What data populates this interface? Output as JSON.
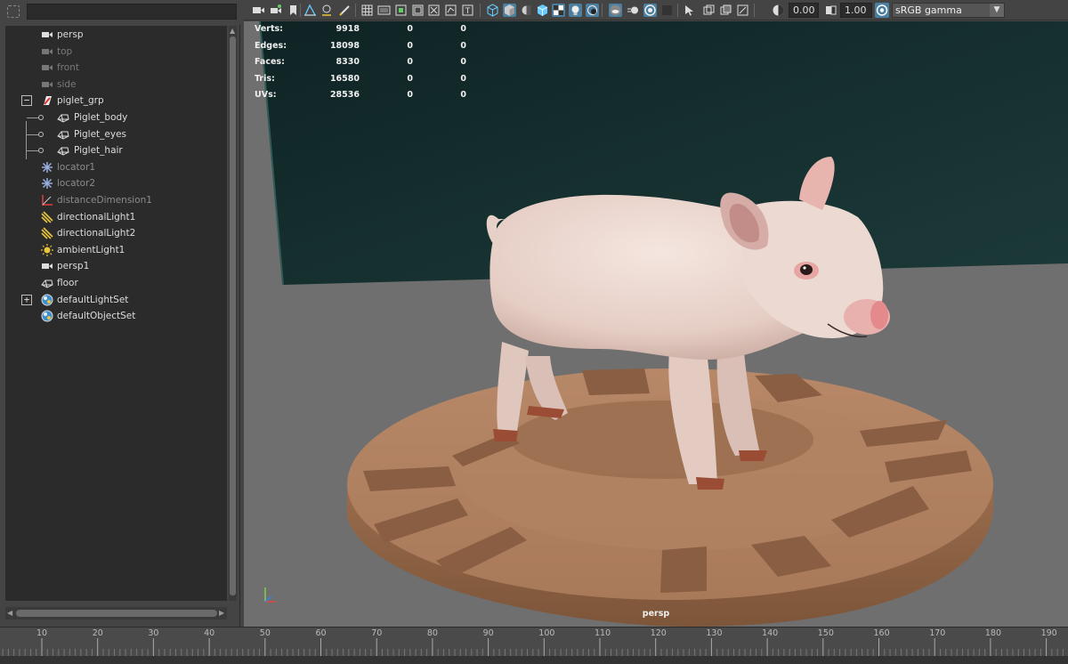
{
  "outliner": {
    "search_value": "",
    "items": [
      {
        "label": "persp",
        "icon": "camera-icon",
        "state": "normal"
      },
      {
        "label": "top",
        "icon": "camera-icon",
        "state": "dim"
      },
      {
        "label": "front",
        "icon": "camera-icon",
        "state": "dim"
      },
      {
        "label": "side",
        "icon": "camera-icon",
        "state": "dim"
      },
      {
        "label": "piglet_grp",
        "icon": "group-transform-icon",
        "state": "normal",
        "expander": "−"
      },
      {
        "label": "Piglet_body",
        "icon": "mesh-icon",
        "state": "normal"
      },
      {
        "label": "Piglet_eyes",
        "icon": "mesh-icon",
        "state": "normal"
      },
      {
        "label": "Piglet_hair",
        "icon": "mesh-icon",
        "state": "normal"
      },
      {
        "label": "locator1",
        "icon": "locator-icon",
        "state": "grey"
      },
      {
        "label": "locator2",
        "icon": "locator-icon",
        "state": "grey"
      },
      {
        "label": "distanceDimension1",
        "icon": "distance-icon",
        "state": "grey"
      },
      {
        "label": "directionalLight1",
        "icon": "directional-light-icon",
        "state": "normal"
      },
      {
        "label": "directionalLight2",
        "icon": "directional-light-icon",
        "state": "normal"
      },
      {
        "label": "ambientLight1",
        "icon": "ambient-light-icon",
        "state": "normal"
      },
      {
        "label": "persp1",
        "icon": "camera-icon",
        "state": "normal"
      },
      {
        "label": "floor",
        "icon": "mesh-icon",
        "state": "normal"
      },
      {
        "label": "defaultLightSet",
        "icon": "set-icon",
        "state": "normal",
        "expander": "+"
      },
      {
        "label": "defaultObjectSet",
        "icon": "set-icon",
        "state": "normal"
      }
    ]
  },
  "toolbar": {
    "exposure_value": "0.00",
    "gamma_value": "1.00",
    "color_management": "sRGB gamma"
  },
  "hud": {
    "rows": [
      {
        "label": "Verts:",
        "v1": "9918",
        "v2": "0",
        "v3": "0"
      },
      {
        "label": "Edges:",
        "v1": "18098",
        "v2": "0",
        "v3": "0"
      },
      {
        "label": "Faces:",
        "v1": "8330",
        "v2": "0",
        "v3": "0"
      },
      {
        "label": "Tris:",
        "v1": "16580",
        "v2": "0",
        "v3": "0"
      },
      {
        "label": "UVs:",
        "v1": "28536",
        "v2": "0",
        "v3": "0"
      }
    ]
  },
  "camera_label": "persp",
  "timeline": {
    "ticks": [
      "10",
      "20",
      "30",
      "40",
      "50",
      "60",
      "70",
      "80",
      "90",
      "100",
      "110",
      "120",
      "130",
      "140",
      "150",
      "160",
      "170",
      "180",
      "190"
    ]
  },
  "colors": {
    "backdrop": "#173030",
    "floor": "#6f6f6f",
    "turntable": "#a87a5a",
    "pig_skin": "#ead6cf",
    "active_tool": "#4a7fa0"
  }
}
